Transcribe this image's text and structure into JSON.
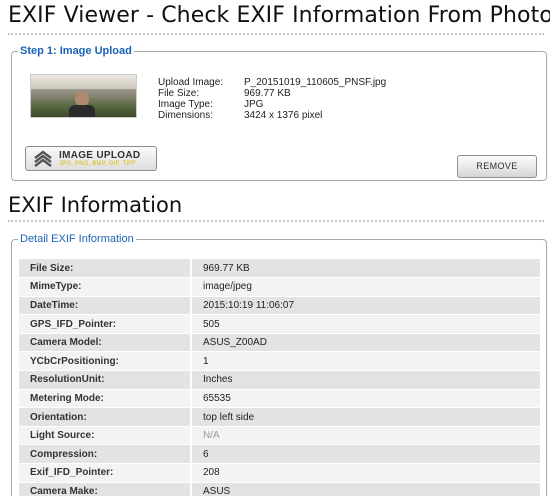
{
  "page": {
    "title": "EXIF Viewer - Check EXIF Information From Photo",
    "section_title": "EXIF Information"
  },
  "upload": {
    "legend": "Step 1: Image Upload",
    "thumbnail_alt": "uploaded photo thumbnail",
    "fields": [
      {
        "label": "Upload Image:",
        "value": "P_20151019_110605_PNSF.jpg"
      },
      {
        "label": "File Size:",
        "value": "969.77 KB"
      },
      {
        "label": "Image Type:",
        "value": "JPG"
      },
      {
        "label": "Dimensions:",
        "value": "3424 x 1376 pixel"
      }
    ],
    "upload_button_label": "IMAGE UPLOAD",
    "upload_button_formats": "JPG, PNG, BMP, GIF, TIFF",
    "remove_button_label": "REMOVE"
  },
  "detail": {
    "legend": "Detail EXIF Information",
    "rows": [
      {
        "key": "File Size:",
        "value": "969.77 KB"
      },
      {
        "key": "MimeType:",
        "value": "image/jpeg"
      },
      {
        "key": "DateTime:",
        "value": "2015:10:19 11:06:07"
      },
      {
        "key": "GPS_IFD_Pointer:",
        "value": "505"
      },
      {
        "key": "Camera Model:",
        "value": "ASUS_Z00AD"
      },
      {
        "key": "YCbCrPositioning:",
        "value": "1"
      },
      {
        "key": "ResolutionUnit:",
        "value": "Inches"
      },
      {
        "key": "Metering Mode:",
        "value": "65535"
      },
      {
        "key": "Orientation:",
        "value": "top left side"
      },
      {
        "key": "Light Source:",
        "value": "N/A"
      },
      {
        "key": "Compression:",
        "value": "6"
      },
      {
        "key": "Exif_IFD_Pointer:",
        "value": "208"
      },
      {
        "key": "Camera Make:",
        "value": "ASUS"
      }
    ]
  },
  "colors": {
    "legend_blue": "#1a63b8",
    "row_dark": "#e3e3e3",
    "row_light": "#f3f3f3",
    "format_yellow": "#d9b800"
  },
  "icons": {
    "upload_button": "upload-arrows-icon"
  }
}
